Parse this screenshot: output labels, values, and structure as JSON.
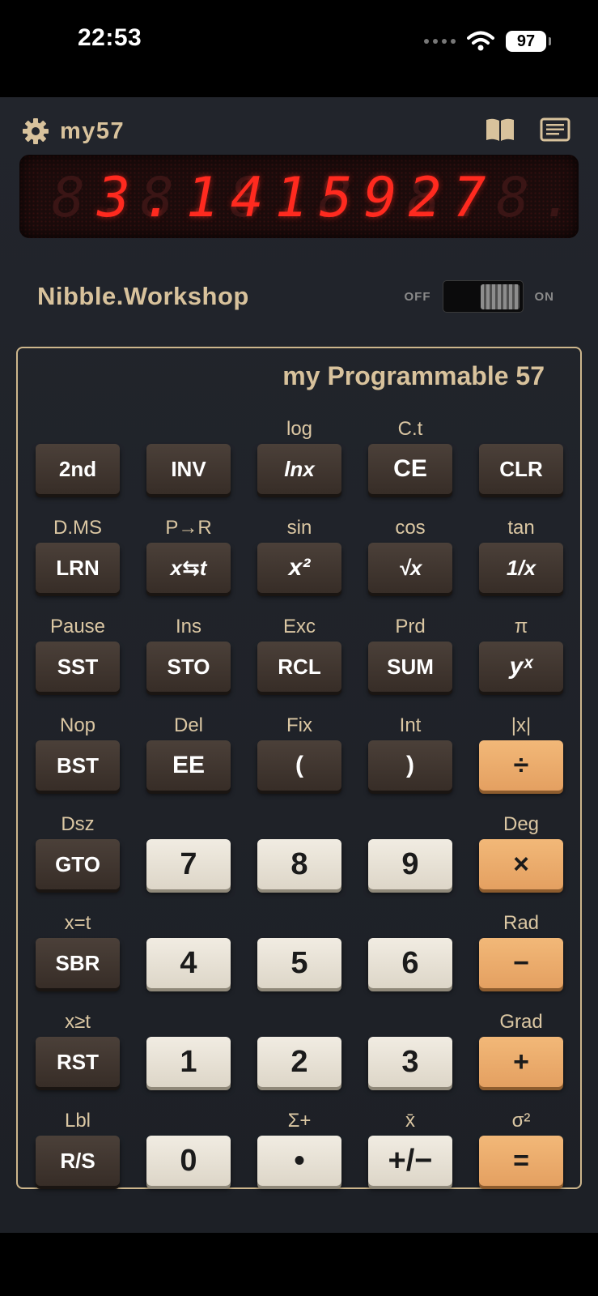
{
  "status": {
    "time": "22:53",
    "battery": "97"
  },
  "app": {
    "title": "my57"
  },
  "display": {
    "ghost": "8.8.8.8.8.8.8.8.8.8.",
    "value": "3.1415927"
  },
  "brand": "Nibble.Workshop",
  "power": {
    "off_label": "OFF",
    "on_label": "ON",
    "state": "on"
  },
  "model": "my Programmable 57",
  "colors": {
    "gold": "#d8c29c",
    "led": "#ff2a1f",
    "dark_key": "#3f352f",
    "light_key": "#e8e2d6",
    "orange_key": "#eba96b"
  },
  "keys": [
    {
      "alt": "",
      "label": "2nd",
      "style": "dark"
    },
    {
      "alt": "",
      "label": "INV",
      "style": "dark"
    },
    {
      "alt": "log",
      "label": "lnx",
      "style": "dark",
      "italic": true
    },
    {
      "alt": "C.t",
      "label": "CE",
      "style": "dark",
      "big": true
    },
    {
      "alt": "",
      "label": "CLR",
      "style": "dark"
    },
    {
      "alt": "D.MS",
      "label": "LRN",
      "style": "dark"
    },
    {
      "alt": "P→R",
      "label": "x⇆t",
      "style": "dark",
      "italic": true
    },
    {
      "alt": "sin",
      "label": "x²",
      "style": "dark",
      "italic": true,
      "big": true
    },
    {
      "alt": "cos",
      "label": "√x",
      "style": "dark",
      "italic": true
    },
    {
      "alt": "tan",
      "label": "1/x",
      "style": "dark",
      "italic": true
    },
    {
      "alt": "Pause",
      "label": "SST",
      "style": "dark"
    },
    {
      "alt": "Ins",
      "label": "STO",
      "style": "dark"
    },
    {
      "alt": "Exc",
      "label": "RCL",
      "style": "dark"
    },
    {
      "alt": "Prd",
      "label": "SUM",
      "style": "dark"
    },
    {
      "alt": "π",
      "label": "yˣ",
      "style": "dark",
      "italic": true,
      "big": true
    },
    {
      "alt": "Nop",
      "label": "BST",
      "style": "dark"
    },
    {
      "alt": "Del",
      "label": "EE",
      "style": "dark",
      "big": true
    },
    {
      "alt": "Fix",
      "label": "(",
      "style": "dark",
      "big": true
    },
    {
      "alt": "Int",
      "label": ")",
      "style": "dark",
      "big": true
    },
    {
      "alt": "|x|",
      "label": "÷",
      "style": "orange"
    },
    {
      "alt": "Dsz",
      "label": "GTO",
      "style": "dark"
    },
    {
      "alt": "",
      "label": "7",
      "style": "light"
    },
    {
      "alt": "",
      "label": "8",
      "style": "light"
    },
    {
      "alt": "",
      "label": "9",
      "style": "light"
    },
    {
      "alt": "Deg",
      "label": "×",
      "style": "orange"
    },
    {
      "alt": "x=t",
      "label": "SBR",
      "style": "dark"
    },
    {
      "alt": "",
      "label": "4",
      "style": "light"
    },
    {
      "alt": "",
      "label": "5",
      "style": "light"
    },
    {
      "alt": "",
      "label": "6",
      "style": "light"
    },
    {
      "alt": "Rad",
      "label": "−",
      "style": "orange"
    },
    {
      "alt": "x≥t",
      "label": "RST",
      "style": "dark"
    },
    {
      "alt": "",
      "label": "1",
      "style": "light"
    },
    {
      "alt": "",
      "label": "2",
      "style": "light"
    },
    {
      "alt": "",
      "label": "3",
      "style": "light"
    },
    {
      "alt": "Grad",
      "label": "+",
      "style": "orange"
    },
    {
      "alt": "Lbl",
      "label": "R/S",
      "style": "dark"
    },
    {
      "alt": "",
      "label": "0",
      "style": "light"
    },
    {
      "alt": "Σ+",
      "label": "•",
      "style": "light"
    },
    {
      "alt": "x̄",
      "label": "+/−",
      "style": "light"
    },
    {
      "alt": "σ²",
      "label": "=",
      "style": "orange"
    }
  ]
}
